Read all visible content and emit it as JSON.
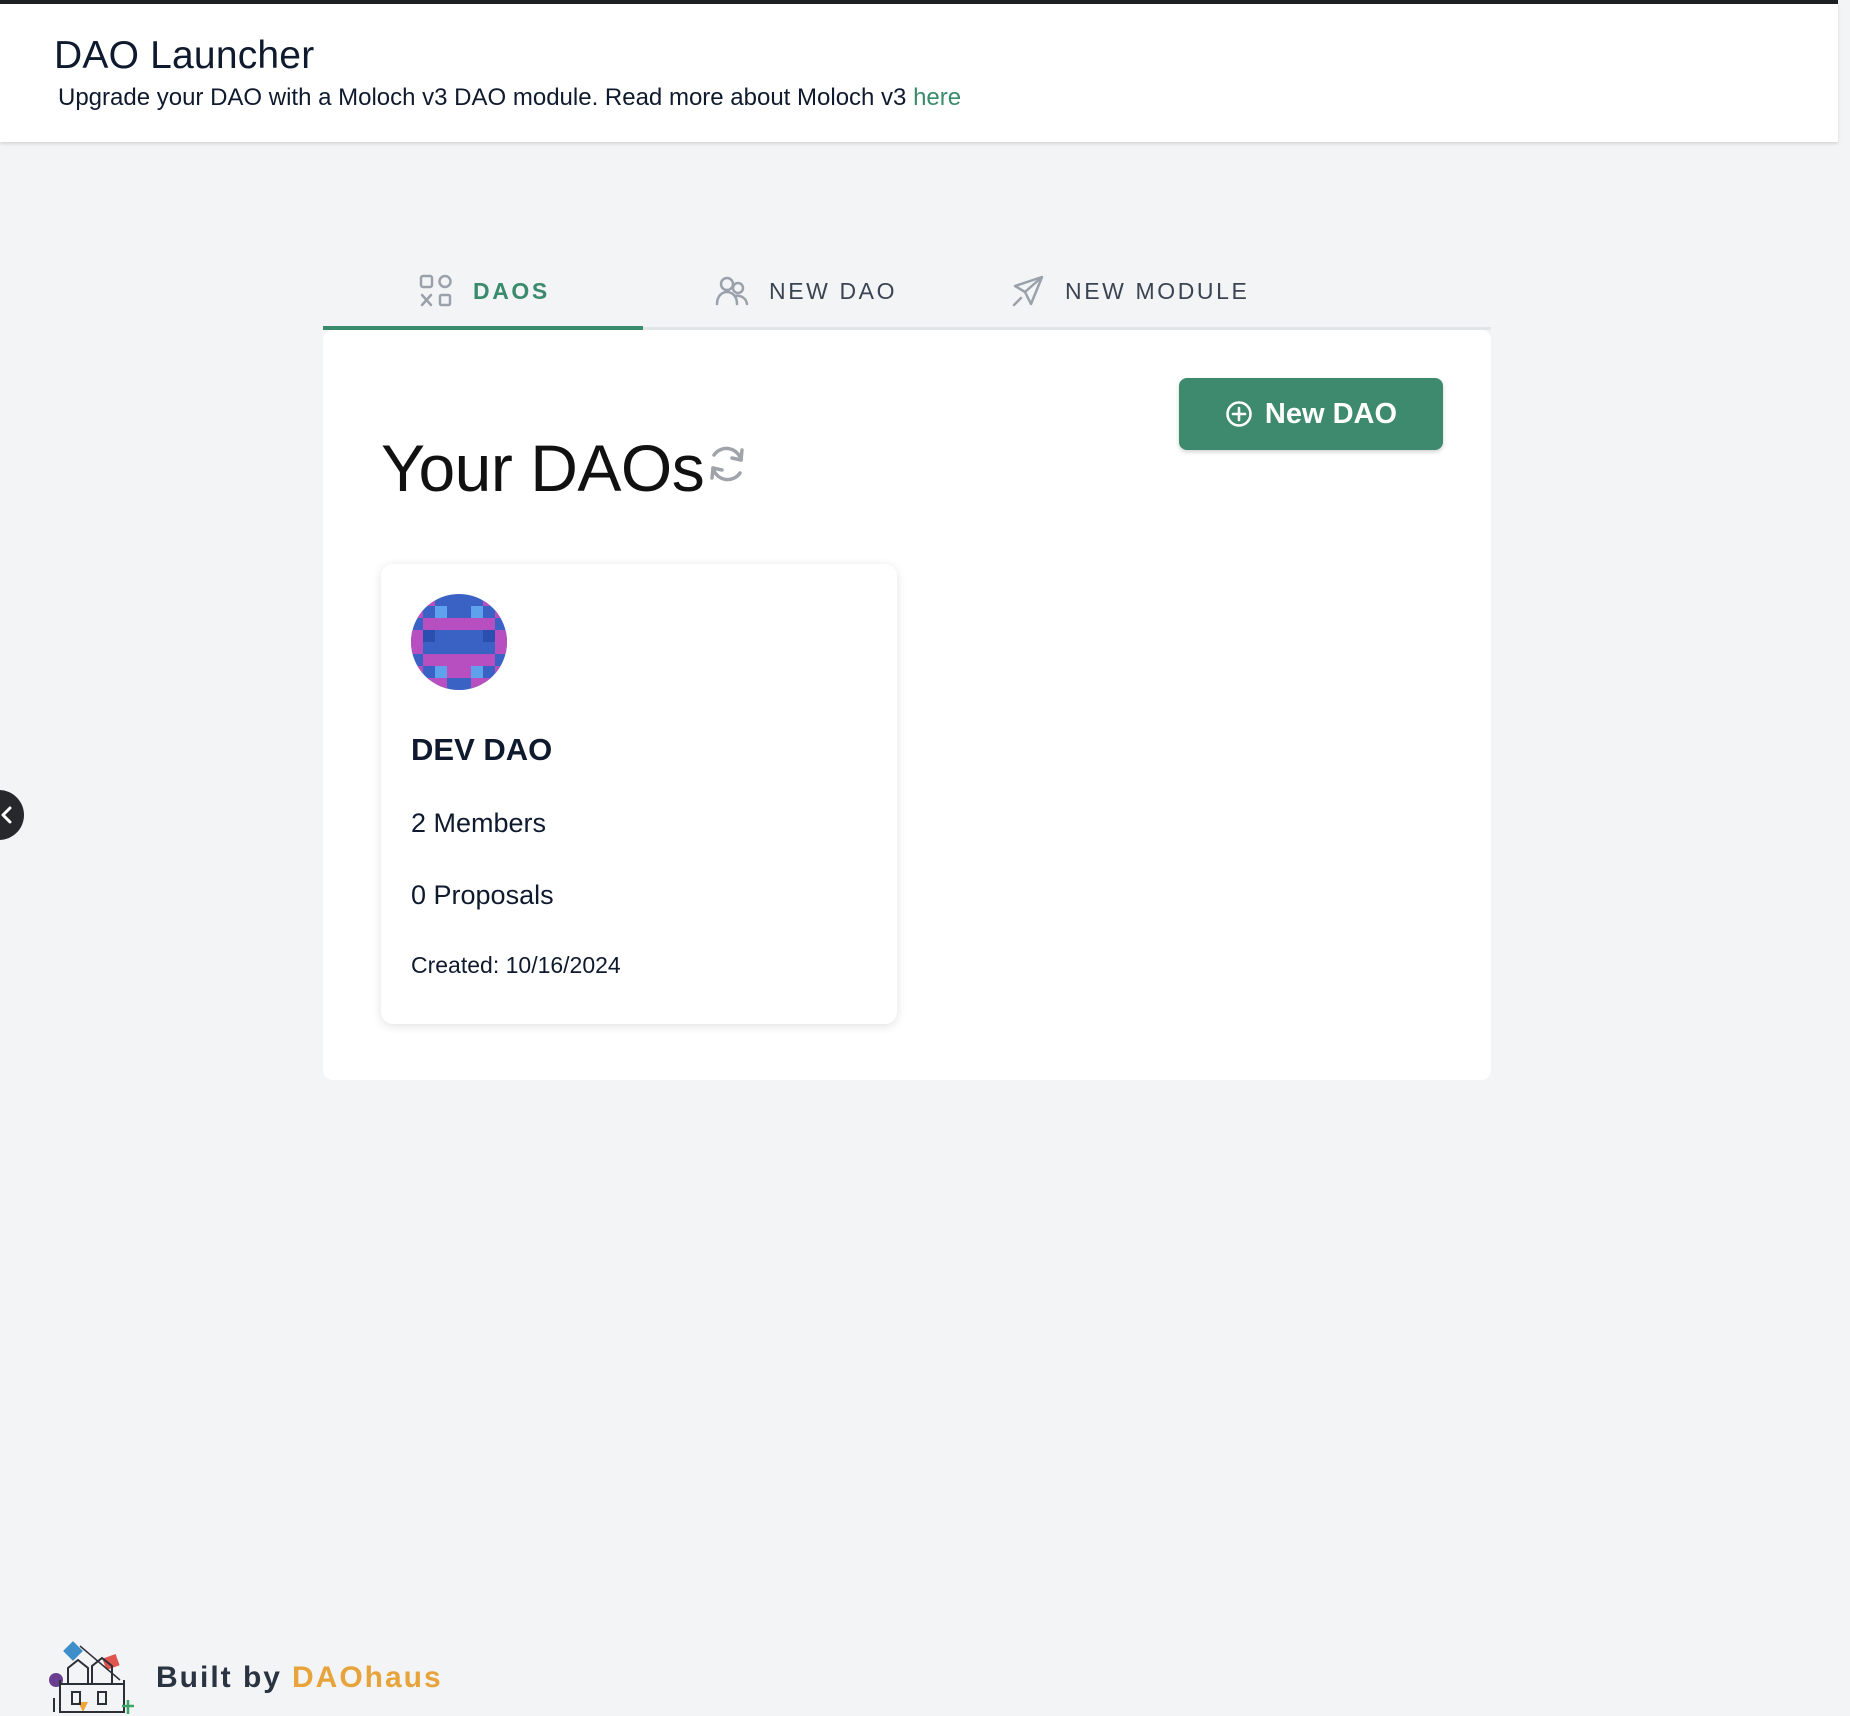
{
  "header": {
    "title": "DAO Launcher",
    "subtitle": "Upgrade your DAO with a Moloch v3 DAO module. Read more about Moloch v3",
    "subtitle_link": "here"
  },
  "tabs": [
    {
      "label": "DAOS",
      "icon": "grid-icon",
      "active": true
    },
    {
      "label": "NEW DAO",
      "icon": "users-icon",
      "active": false
    },
    {
      "label": "NEW MODULE",
      "icon": "rocket-icon",
      "active": false
    }
  ],
  "main": {
    "title": "Your DAOs",
    "new_dao_button": "New DAO",
    "refresh_icon": "refresh-icon"
  },
  "daos": [
    {
      "name": "DEV DAO",
      "members": "2 Members",
      "proposals": "0 Proposals",
      "created": "Created: 10/16/2024"
    }
  ],
  "footer": {
    "built_by": "Built by",
    "brand": "DAOhaus"
  },
  "colors": {
    "accent": "#3a8a6c",
    "brand": "#e8a43c",
    "background": "#f3f4f6"
  }
}
